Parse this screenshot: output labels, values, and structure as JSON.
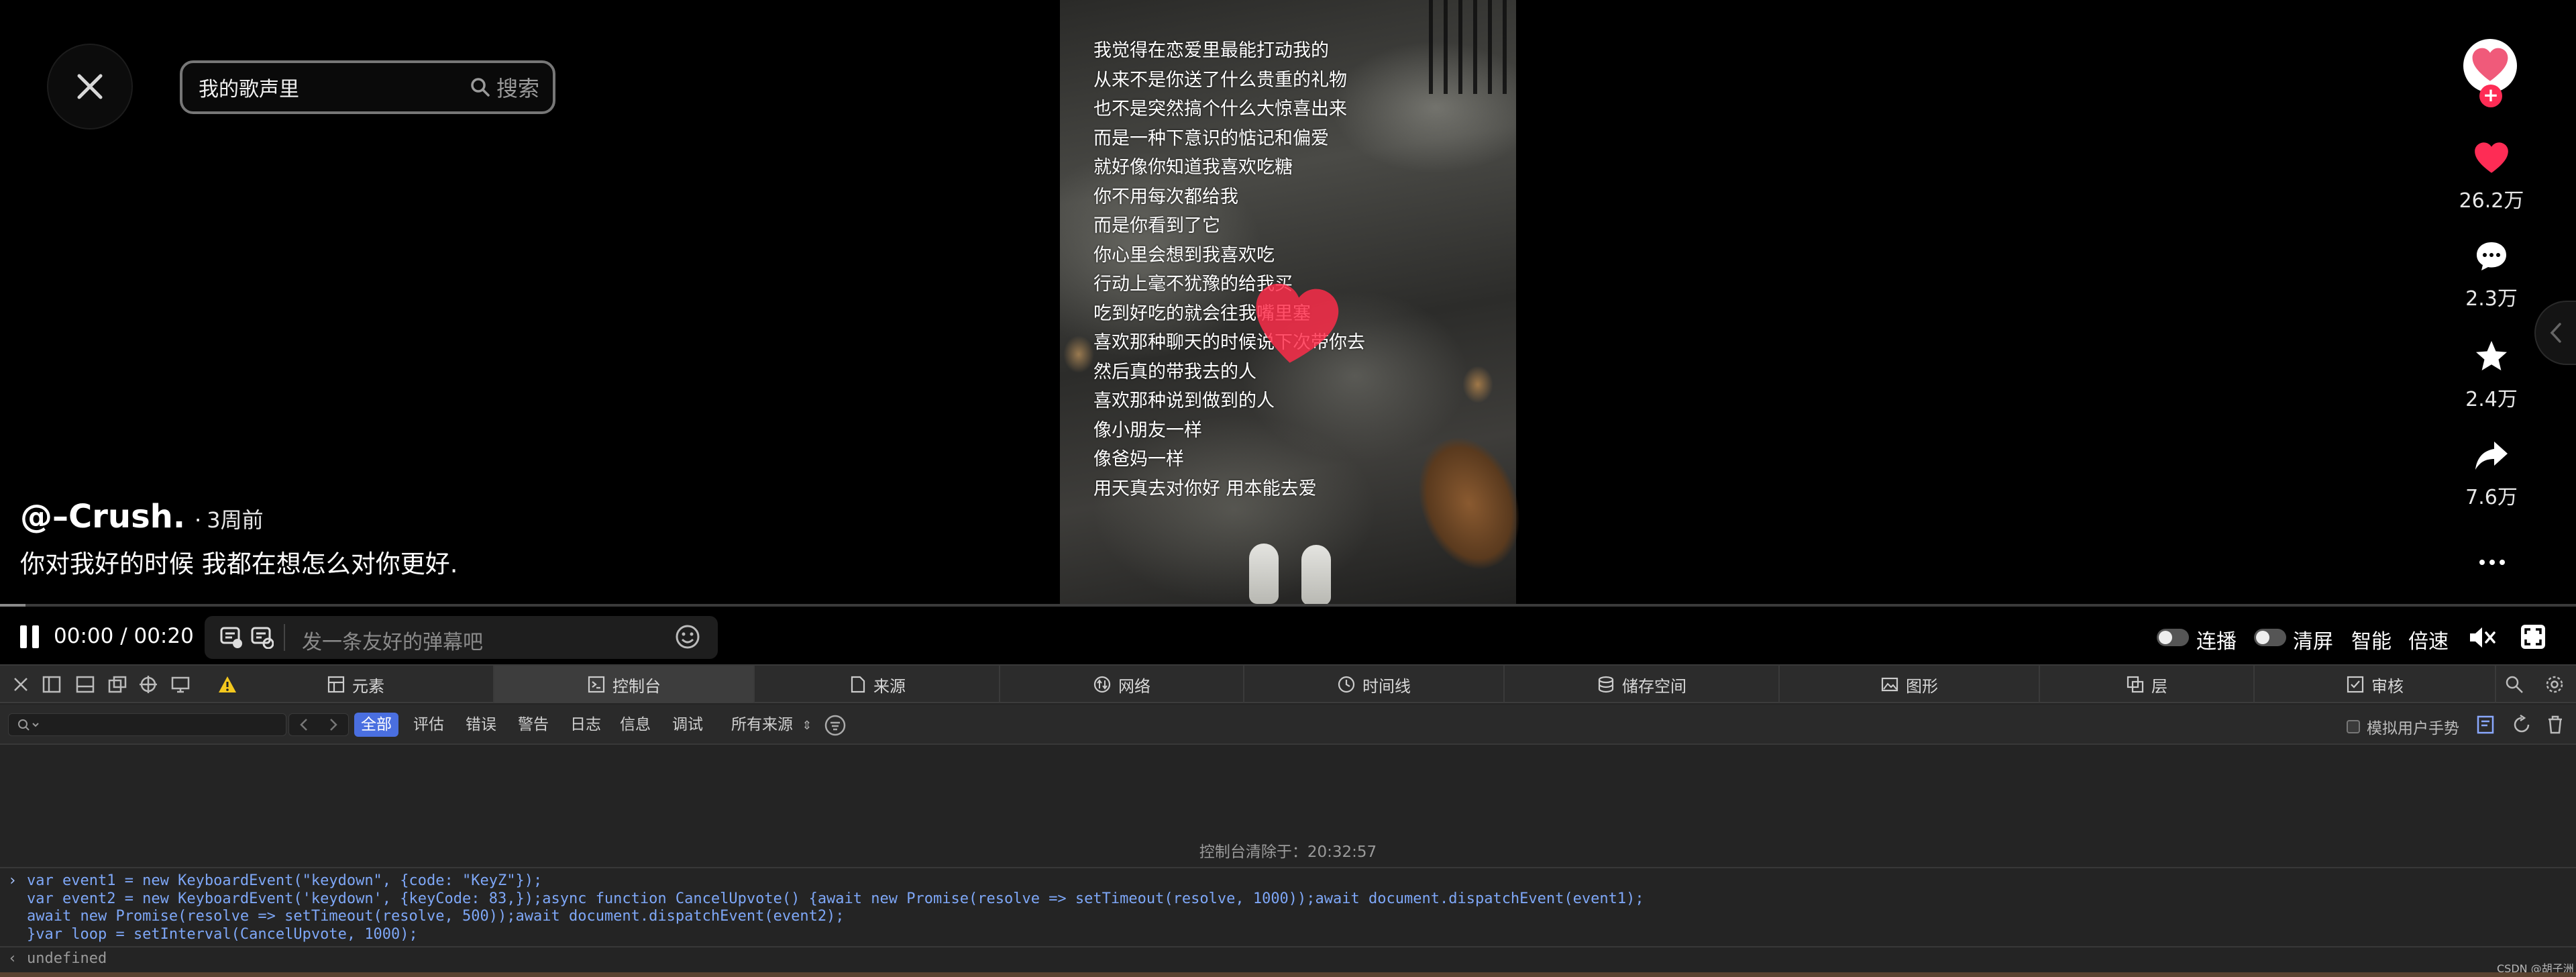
{
  "search": {
    "query": "我的歌声里",
    "button_label": "搜索"
  },
  "lyrics": [
    "我觉得在恋爱里最能打动我的",
    "从来不是你送了什么贵重的礼物",
    "也不是突然搞个什么大惊喜出来",
    "而是一种下意识的惦记和偏爱",
    "就好像你知道我喜欢吃糖",
    "你不用每次都给我",
    "而是你看到了它",
    "你心里会想到我喜欢吃",
    "行动上毫不犹豫的给我买",
    "吃到好吃的就会往我嘴里塞",
    "喜欢那种聊天的时候说下次带你去",
    "然后真的带我去的人",
    "喜欢那种说到做到的人",
    "像小朋友一样",
    "像爸妈一样",
    "用天真去对你好 用本能去爱"
  ],
  "author": {
    "name": "@–Crush.",
    "separator": "·",
    "posted": "3周前"
  },
  "description": "你对我好的时候 我都在想怎么对你更好.",
  "rail": {
    "follow_symbol": "+",
    "likes": "26.2万",
    "comments": "2.3万",
    "favorites": "2.4万",
    "shares": "7.6万"
  },
  "player": {
    "time": "00:00 / 00:20",
    "progress_fraction": 0.01,
    "danmaku_placeholder": "发一条友好的弹幕吧",
    "autoplay_label": "连播",
    "clean_label": "清屏",
    "smart_label": "智能",
    "speed_label": "倍速"
  },
  "devtools": {
    "tabs": [
      {
        "label": "元素",
        "icon": "elements-icon"
      },
      {
        "label": "控制台",
        "icon": "console-icon"
      },
      {
        "label": "来源",
        "icon": "sources-icon"
      },
      {
        "label": "网络",
        "icon": "network-icon"
      },
      {
        "label": "时间线",
        "icon": "timeline-icon"
      },
      {
        "label": "储存空间",
        "icon": "storage-icon"
      },
      {
        "label": "图形",
        "icon": "graphics-icon"
      },
      {
        "label": "层",
        "icon": "layers-icon"
      },
      {
        "label": "审核",
        "icon": "audit-icon"
      }
    ],
    "levels": [
      "全部",
      "评估",
      "错误",
      "警告",
      "日志",
      "信息",
      "调试"
    ],
    "source_select": "所有来源",
    "touch_sim_label": "模拟用户手势",
    "cleared_message": "控制台清除于：20:32:57",
    "command_prompt": "›",
    "command_lines": [
      "var event1 = new KeyboardEvent(\"keydown\", {code: \"KeyZ\"});",
      "var event2 = new KeyboardEvent('keydown', {keyCode: 83,});async function CancelUpvote() {await new Promise(resolve => setTimeout(resolve, 1000));await document.dispatchEvent(event1);",
      "await new Promise(resolve => setTimeout(resolve, 500));await document.dispatchEvent(event2);",
      "}var loop = setInterval(CancelUpvote, 1000);"
    ],
    "result_arrow": "‹",
    "result": "undefined"
  },
  "watermark": "CSDN @胡子洲",
  "colors": {
    "accent": "#fe2c55",
    "filter_active": "#4a6fe0",
    "command_text": "#7ea7f7"
  }
}
